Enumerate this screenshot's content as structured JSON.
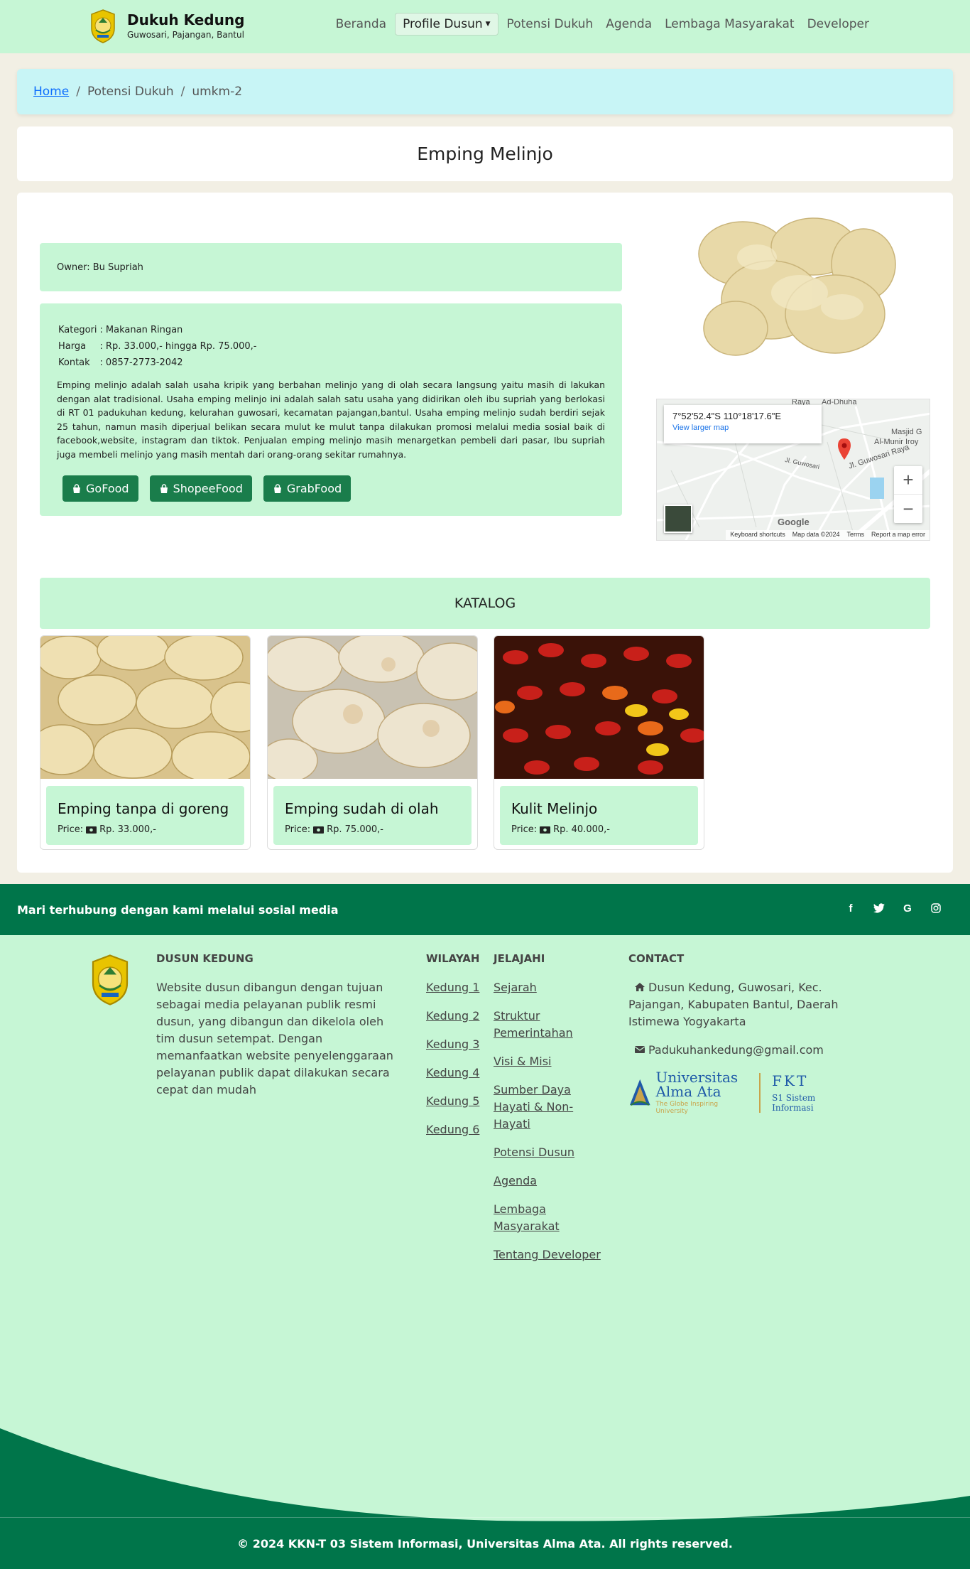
{
  "brand": {
    "title": "Dukuh Kedung",
    "subtitle": "Guwosari, Pajangan, Bantul"
  },
  "nav": {
    "beranda": "Beranda",
    "profile": "Profile Dusun",
    "potensi": "Potensi Dukuh",
    "agenda": "Agenda",
    "lembaga": "Lembaga Masyarakat",
    "developer": "Developer"
  },
  "breadcrumb": {
    "home": "Home",
    "section": "Potensi Dukuh",
    "current": "umkm-2"
  },
  "page_title": "Emping Melinjo",
  "owner": "Owner: Bu Supriah",
  "details": {
    "kategori_label": "Kategori",
    "kategori": "Makanan Ringan",
    "harga_label": "Harga",
    "harga": "Rp. 33.000,- hingga Rp. 75.000,-",
    "kontak_label": "Kontak",
    "kontak": "0857-2773-2042",
    "sep": ":"
  },
  "description": "Emping melinjo adalah salah usaha kripik yang berbahan melinjo yang di olah secara langsung yaitu masih di lakukan dengan alat tradisional. Usaha emping melinjo ini adalah salah satu usaha yang didirikan oleh ibu supriah yang berlokasi di RT 01 padukuhan kedung, kelurahan guwosari, kecamatan pajangan,bantul. Usaha emping melinjo sudah berdiri sejak 25 tahun, namun masih diperjual belikan secara mulut ke mulut tanpa dilakukan promosi melalui media sosial baik di facebook,website, instagram dan tiktok. Penjualan emping melinjo masih menargetkan pembeli dari pasar, Ibu supriah juga membeli melinjo yang masih mentah dari orang-orang sekitar rumahnya.",
  "order_buttons": [
    "GoFood",
    "ShopeeFood",
    "GrabFood"
  ],
  "map": {
    "coords": "7°52'52.4\"S 110°18'17.6\"E",
    "larger": "View larger map",
    "place1": "Ad-Dhuha",
    "place2": "Masjid G",
    "place3": "Al-Munir Iroy",
    "road1": "Jl. Guwosari Raya",
    "road2": "Jl. Guwosari",
    "road3": "Raya",
    "google": "Google",
    "footer": [
      "Keyboard shortcuts",
      "Map data ©2024",
      "Terms",
      "Report a map error"
    ]
  },
  "katalog_title": "KATALOG",
  "catalog": [
    {
      "name": "Emping tanpa di goreng",
      "price_label": "Price:",
      "price": "Rp. 33.000,-"
    },
    {
      "name": "Emping sudah di olah",
      "price_label": "Price:",
      "price": "Rp. 75.000,-"
    },
    {
      "name": "Kulit Melinjo",
      "price_label": "Price:",
      "price": "Rp. 40.000,-"
    }
  ],
  "social": {
    "text": "Mari terhubung dengan kami melalui sosial media",
    "icons": [
      "facebook-icon",
      "twitter-icon",
      "google-icon",
      "instagram-icon"
    ]
  },
  "footer": {
    "about_title": "DUSUN KEDUNG",
    "about_text": "Website dusun dibangun dengan tujuan sebagai media pelayanan publik resmi dusun, yang dibangun dan dikelola oleh tim dusun setempat. Dengan memanfaatkan website penyelenggaraan pelayanan publik dapat dilakukan secara cepat dan mudah",
    "wilayah_title": "WILAYAH",
    "wilayah": [
      "Kedung 1",
      "Kedung 2",
      "Kedung 3",
      "Kedung 4",
      "Kedung 5",
      "Kedung 6"
    ],
    "jelajahi_title": "JELAJAHI",
    "jelajahi": [
      "Sejarah",
      "Struktur Pemerintahan",
      "Visi & Misi",
      "Sumber Daya Hayati & Non-Hayati",
      "Potensi Dusun",
      "Agenda",
      "Lembaga Masyarakat",
      "Tentang Developer"
    ],
    "contact_title": "CONTACT",
    "address": "Dusun Kedung, Guwosari, Kec. Pajangan, Kabupaten Bantul, Daerah Istimewa Yogyakarta",
    "email": "Padukuhankedung@gmail.com",
    "uni_line1": "Universitas",
    "uni_line2": "Alma Ata",
    "uni_tag": "The Globe Inspiring University",
    "fkt": "FKT",
    "fkt_sub": "S1 Sistem Informasi"
  },
  "copyright": "© 2024 KKN-T 03 Sistem Informasi, Universitas Alma Ata. All rights reserved.",
  "colors": {
    "mint": "#c6f6d5",
    "dark_green": "#00754a",
    "button_green": "#1a7d4b",
    "breadcrumb_bg": "#c8f5f6",
    "page_bg": "#f2efe4"
  }
}
